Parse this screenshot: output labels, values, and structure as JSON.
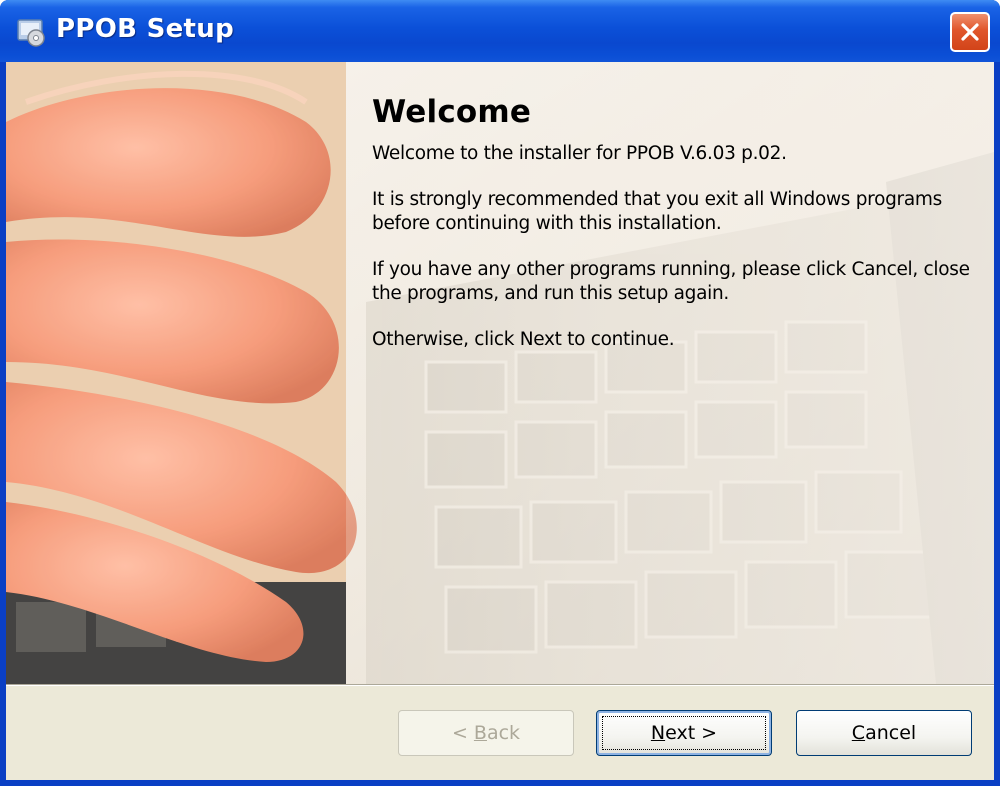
{
  "window": {
    "title": "PPOB Setup",
    "icon": "setup-icon",
    "close_icon": "close-icon",
    "close_color": "#d8481d",
    "titlebar_color": "#0b4fd6"
  },
  "content": {
    "heading": "Welcome",
    "paragraphs": [
      "Welcome to the installer for PPOB V.6.03 p.02.",
      "It is strongly recommended that you exit all Windows programs before continuing with this installation.",
      "If you have any other programs running, please click Cancel, close the programs, and run this setup again.",
      "Otherwise, click Next to continue."
    ],
    "side_image": "hand-typing-keyboard-photo"
  },
  "buttons": {
    "back": {
      "label": "< Back",
      "mnemonic": "B",
      "enabled": false
    },
    "next": {
      "label": "Next >",
      "mnemonic": "N",
      "enabled": true,
      "default": true
    },
    "cancel": {
      "label": "Cancel",
      "mnemonic": "C",
      "enabled": true
    }
  }
}
